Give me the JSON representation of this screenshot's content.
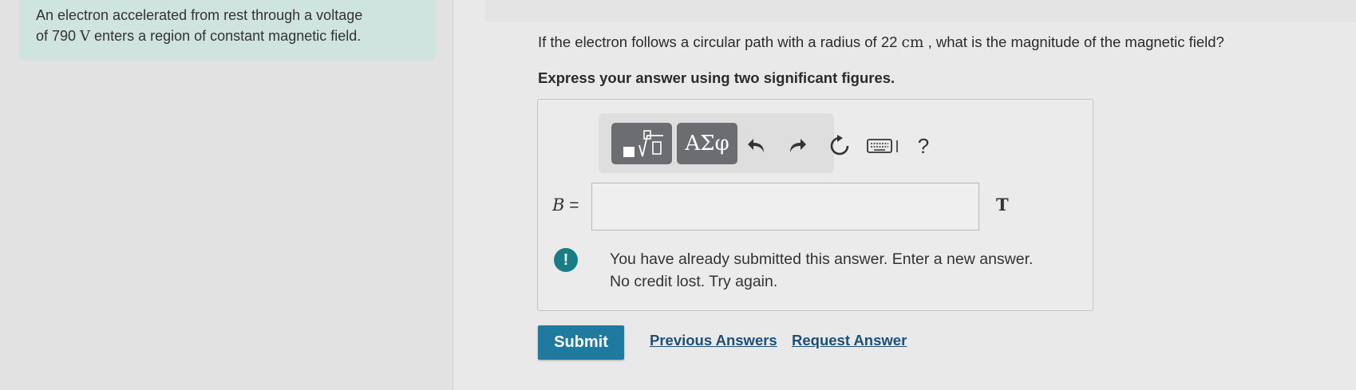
{
  "problem": {
    "intro_line1": "An electron accelerated from rest through a voltage",
    "intro_line2_pre": "of 790 ",
    "intro_line2_unit": "V",
    "intro_line2_post": " enters a region of constant magnetic field.",
    "question_pre": "If the electron follows a circular path with a radius of 22 ",
    "question_unit": "cm",
    "question_post": " , what is the magnitude of the magnetic field?",
    "instruction": "Express your answer using two significant figures."
  },
  "toolbar": {
    "symbols_label": "ΑΣφ",
    "help_label": "?"
  },
  "answer": {
    "variable": "B",
    "equals": " =",
    "value": "",
    "unit": "T"
  },
  "feedback": {
    "icon_label": "!",
    "line1": "You have already submitted this answer. Enter a new answer.",
    "line2": "No credit lost. Try again."
  },
  "actions": {
    "submit_label": "Submit",
    "previous_answers_label": "Previous Answers",
    "request_answer_label": "Request Answer"
  },
  "colors": {
    "intro_background": "#cfe3df",
    "submit_background": "#1f7aa0",
    "link_color": "#1e4f78",
    "feedback_icon": "#1a7d86"
  }
}
